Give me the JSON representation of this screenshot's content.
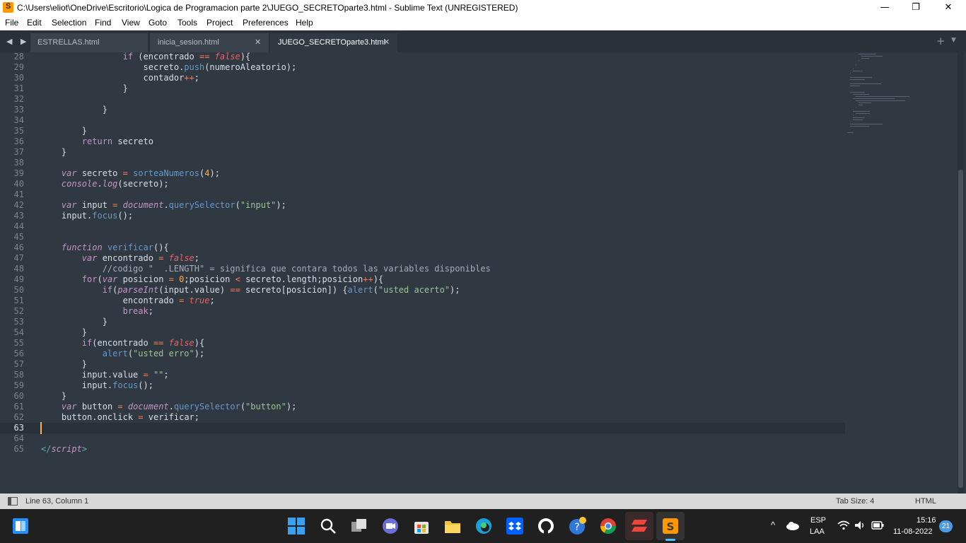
{
  "window": {
    "title": "C:\\Users\\eliot\\OneDrive\\Escritorio\\Logica de Programacion parte 2\\JUEGO_SECRETOparte3.html - Sublime Text (UNREGISTERED)",
    "app_icon_letter": "S",
    "minimize_symbol": "—",
    "restore_symbol": "❐",
    "close_symbol": "✕"
  },
  "menu": [
    "File",
    "Edit",
    "Selection",
    "Find",
    "View",
    "Goto",
    "Tools",
    "Project",
    "Preferences",
    "Help"
  ],
  "tabs": {
    "nav_symbol": "◀ ▶",
    "items": [
      {
        "label": "ESTRELLAS.html",
        "active": false
      },
      {
        "label": "inicia_sesion.html",
        "active": false
      },
      {
        "label": "JUEGO_SECRETOparte3.html",
        "active": true
      }
    ],
    "close_symbol": "✕",
    "new_tab_symbol": "+",
    "dropdown_symbol": "▼"
  },
  "editor": {
    "current_line": 63,
    "lines": [
      {
        "n": 28,
        "tokens": [
          [
            "                ",
            "id"
          ],
          [
            "if",
            "kw2"
          ],
          [
            " (encontrado ",
            "id"
          ],
          [
            "==",
            "op"
          ],
          [
            " ",
            "id"
          ],
          [
            "false",
            "bool"
          ],
          [
            "){",
            "id"
          ]
        ]
      },
      {
        "n": 29,
        "tokens": [
          [
            "                    secreto.",
            "id"
          ],
          [
            "push",
            "fn"
          ],
          [
            "(numeroAleatorio);",
            "id"
          ]
        ]
      },
      {
        "n": 30,
        "tokens": [
          [
            "                    contador",
            "id"
          ],
          [
            "++",
            "op"
          ],
          [
            ";",
            "id"
          ]
        ]
      },
      {
        "n": 31,
        "tokens": [
          [
            "                }",
            "id"
          ]
        ]
      },
      {
        "n": 32,
        "tokens": []
      },
      {
        "n": 33,
        "tokens": [
          [
            "            }",
            "id"
          ]
        ]
      },
      {
        "n": 34,
        "tokens": []
      },
      {
        "n": 35,
        "tokens": [
          [
            "        }",
            "id"
          ]
        ]
      },
      {
        "n": 36,
        "tokens": [
          [
            "        ",
            "id"
          ],
          [
            "return",
            "kw2"
          ],
          [
            " secreto",
            "id"
          ]
        ]
      },
      {
        "n": 37,
        "tokens": [
          [
            "    }",
            "id"
          ]
        ]
      },
      {
        "n": 38,
        "tokens": []
      },
      {
        "n": 39,
        "tokens": [
          [
            "    ",
            "id"
          ],
          [
            "var",
            "kw"
          ],
          [
            " secreto ",
            "id"
          ],
          [
            "=",
            "op"
          ],
          [
            " ",
            "id"
          ],
          [
            "sorteaNumeros",
            "fn"
          ],
          [
            "(",
            "id"
          ],
          [
            "4",
            "num"
          ],
          [
            ");",
            "id"
          ]
        ]
      },
      {
        "n": 40,
        "tokens": [
          [
            "    ",
            "id"
          ],
          [
            "console",
            "kw"
          ],
          [
            ".",
            "id"
          ],
          [
            "log",
            "kw"
          ],
          [
            "(secreto);",
            "id"
          ]
        ]
      },
      {
        "n": 41,
        "tokens": []
      },
      {
        "n": 42,
        "tokens": [
          [
            "    ",
            "id"
          ],
          [
            "var",
            "kw"
          ],
          [
            " input ",
            "id"
          ],
          [
            "=",
            "op"
          ],
          [
            " ",
            "id"
          ],
          [
            "document",
            "kw"
          ],
          [
            ".",
            "id"
          ],
          [
            "querySelector",
            "fn"
          ],
          [
            "(",
            "id"
          ],
          [
            "\"input\"",
            "str"
          ],
          [
            ");",
            "id"
          ]
        ]
      },
      {
        "n": 43,
        "tokens": [
          [
            "    input.",
            "id"
          ],
          [
            "focus",
            "fn"
          ],
          [
            "();",
            "id"
          ]
        ]
      },
      {
        "n": 44,
        "tokens": []
      },
      {
        "n": 45,
        "tokens": []
      },
      {
        "n": 46,
        "tokens": [
          [
            "    ",
            "id"
          ],
          [
            "function",
            "kw"
          ],
          [
            " ",
            "id"
          ],
          [
            "verificar",
            "fn"
          ],
          [
            "(){",
            "id"
          ]
        ]
      },
      {
        "n": 47,
        "tokens": [
          [
            "        ",
            "id"
          ],
          [
            "var",
            "kw"
          ],
          [
            " encontrado ",
            "id"
          ],
          [
            "=",
            "op"
          ],
          [
            " ",
            "id"
          ],
          [
            "false",
            "bool"
          ],
          [
            ";",
            "id"
          ]
        ]
      },
      {
        "n": 48,
        "tokens": [
          [
            "            //codigo \"  .LENGTH\" = significa que contara todos las variables disponibles",
            "cmt"
          ]
        ]
      },
      {
        "n": 49,
        "tokens": [
          [
            "        ",
            "id"
          ],
          [
            "for",
            "kw2"
          ],
          [
            "(",
            "id"
          ],
          [
            "var",
            "kw"
          ],
          [
            " posicion ",
            "id"
          ],
          [
            "=",
            "op"
          ],
          [
            " ",
            "id"
          ],
          [
            "0",
            "num"
          ],
          [
            ";posicion ",
            "id"
          ],
          [
            "<",
            "op"
          ],
          [
            " secreto.length;posicion",
            "id"
          ],
          [
            "++",
            "op"
          ],
          [
            "){",
            "id"
          ]
        ]
      },
      {
        "n": 50,
        "tokens": [
          [
            "            ",
            "id"
          ],
          [
            "if",
            "kw2"
          ],
          [
            "(",
            "id"
          ],
          [
            "parseInt",
            "kw"
          ],
          [
            "(input.value) ",
            "id"
          ],
          [
            "==",
            "op"
          ],
          [
            " secreto[posicion]) {",
            "id"
          ],
          [
            "alert",
            "fn"
          ],
          [
            "(",
            "id"
          ],
          [
            "\"usted acerto\"",
            "str"
          ],
          [
            ");",
            "id"
          ]
        ]
      },
      {
        "n": 51,
        "tokens": [
          [
            "                encontrado ",
            "id"
          ],
          [
            "=",
            "op"
          ],
          [
            " ",
            "id"
          ],
          [
            "true",
            "bool"
          ],
          [
            ";",
            "id"
          ]
        ]
      },
      {
        "n": 52,
        "tokens": [
          [
            "                ",
            "id"
          ],
          [
            "break",
            "kw2"
          ],
          [
            ";",
            "id"
          ]
        ]
      },
      {
        "n": 53,
        "tokens": [
          [
            "            }",
            "id"
          ]
        ]
      },
      {
        "n": 54,
        "tokens": [
          [
            "        }",
            "id"
          ]
        ]
      },
      {
        "n": 55,
        "tokens": [
          [
            "        ",
            "id"
          ],
          [
            "if",
            "kw2"
          ],
          [
            "(encontrado ",
            "id"
          ],
          [
            "==",
            "op"
          ],
          [
            " ",
            "id"
          ],
          [
            "false",
            "bool"
          ],
          [
            "){",
            "id"
          ]
        ]
      },
      {
        "n": 56,
        "tokens": [
          [
            "            ",
            "id"
          ],
          [
            "alert",
            "fn"
          ],
          [
            "(",
            "id"
          ],
          [
            "\"usted erro\"",
            "str"
          ],
          [
            ");",
            "id"
          ]
        ]
      },
      {
        "n": 57,
        "tokens": [
          [
            "        }",
            "id"
          ]
        ]
      },
      {
        "n": 58,
        "tokens": [
          [
            "        input.value ",
            "id"
          ],
          [
            "=",
            "op"
          ],
          [
            " ",
            "id"
          ],
          [
            "\"\"",
            "str"
          ],
          [
            ";",
            "id"
          ]
        ]
      },
      {
        "n": 59,
        "tokens": [
          [
            "        input.",
            "id"
          ],
          [
            "focus",
            "fn"
          ],
          [
            "();",
            "id"
          ]
        ]
      },
      {
        "n": 60,
        "tokens": [
          [
            "    }",
            "id"
          ]
        ]
      },
      {
        "n": 61,
        "tokens": [
          [
            "    ",
            "id"
          ],
          [
            "var",
            "kw"
          ],
          [
            " button ",
            "id"
          ],
          [
            "=",
            "op"
          ],
          [
            " ",
            "id"
          ],
          [
            "document",
            "kw"
          ],
          [
            ".",
            "id"
          ],
          [
            "querySelector",
            "fn"
          ],
          [
            "(",
            "id"
          ],
          [
            "\"button\"",
            "str"
          ],
          [
            ");",
            "id"
          ]
        ]
      },
      {
        "n": 62,
        "tokens": [
          [
            "    button.onclick ",
            "id"
          ],
          [
            "=",
            "op"
          ],
          [
            " verificar;",
            "id"
          ]
        ]
      },
      {
        "n": 63,
        "tokens": []
      },
      {
        "n": 64,
        "tokens": []
      },
      {
        "n": 65,
        "tokens": [
          [
            "</",
            "tag"
          ],
          [
            "script",
            "kw"
          ],
          [
            ">",
            "tag"
          ]
        ]
      }
    ]
  },
  "status": {
    "position": "Line 63, Column 1",
    "tab_size": "Tab Size: 4",
    "syntax": "HTML"
  },
  "taskbar": {
    "icons": [
      "start-icon",
      "search-icon",
      "task-view-icon",
      "chat-icon",
      "store-icon",
      "file-explorer-icon",
      "edge-icon",
      "dropbox-icon",
      "github-icon",
      "help-icon",
      "chrome-icon",
      "anydesk-icon",
      "sublime-text-icon"
    ],
    "tray_chevron": "^",
    "language_line1": "ESP",
    "language_line2": "LAA",
    "time": "15:16",
    "date": "11-08-2022",
    "notification_count": "21"
  },
  "colors": {
    "editor_bg": "#303841",
    "keyword": "#c594c5",
    "function": "#6699cc",
    "string": "#99c794",
    "operator": "#f97b58",
    "number": "#f9ae58",
    "boolean": "#ec5f66",
    "caret": "#f9ae58"
  }
}
